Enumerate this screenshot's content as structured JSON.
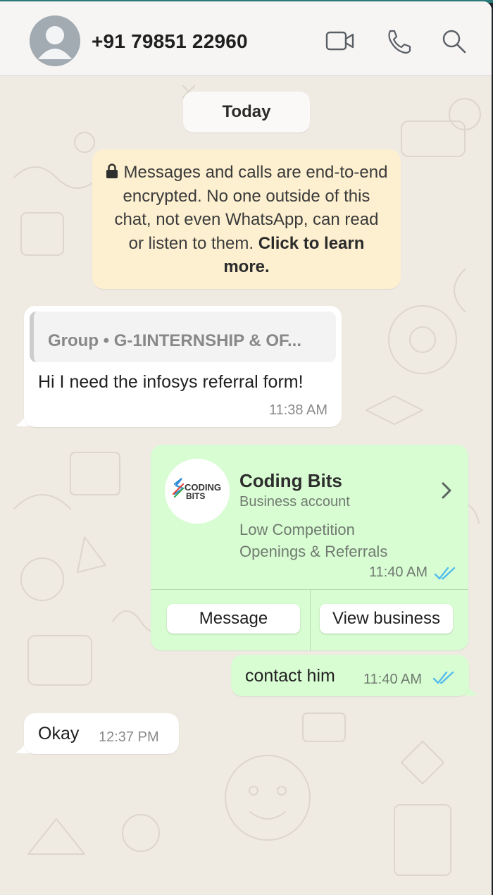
{
  "header": {
    "contact_name": "+91 79851 22960",
    "icons": [
      "video-call-icon",
      "voice-call-icon",
      "search-icon"
    ]
  },
  "date_separator": "Today",
  "encryption_notice": {
    "text": "Messages and calls are end-to-end encrypted. No one outside of this chat, not even WhatsApp, can read or listen to them.",
    "link": "Click to learn more."
  },
  "messages": [
    {
      "direction": "incoming",
      "quoted_from": "Group • G-1INTERNSHIP & OF...",
      "text": "Hi I need the infosys referral form!",
      "time": "11:38 AM"
    },
    {
      "direction": "outgoing",
      "type": "business_contact",
      "business_name": "Coding Bits",
      "account_type": "Business account",
      "description_line_1": "Low Competition",
      "description_line_2": "Openings & Referrals",
      "logo_text": "CODING BITS",
      "time": "11:40 AM",
      "status": "read",
      "buttons": [
        "Message",
        "View business"
      ]
    },
    {
      "direction": "outgoing",
      "text": "contact him",
      "time": "11:40 AM",
      "status": "read"
    },
    {
      "direction": "incoming",
      "text": "Okay",
      "time": "12:37 PM"
    }
  ],
  "colors": {
    "chat_background": "#efeae2",
    "outgoing_bubble": "#d9fdd3",
    "incoming_bubble": "#ffffff",
    "encryption_bubble": "#fdf0d1",
    "read_ticks": "#53bdeb"
  }
}
